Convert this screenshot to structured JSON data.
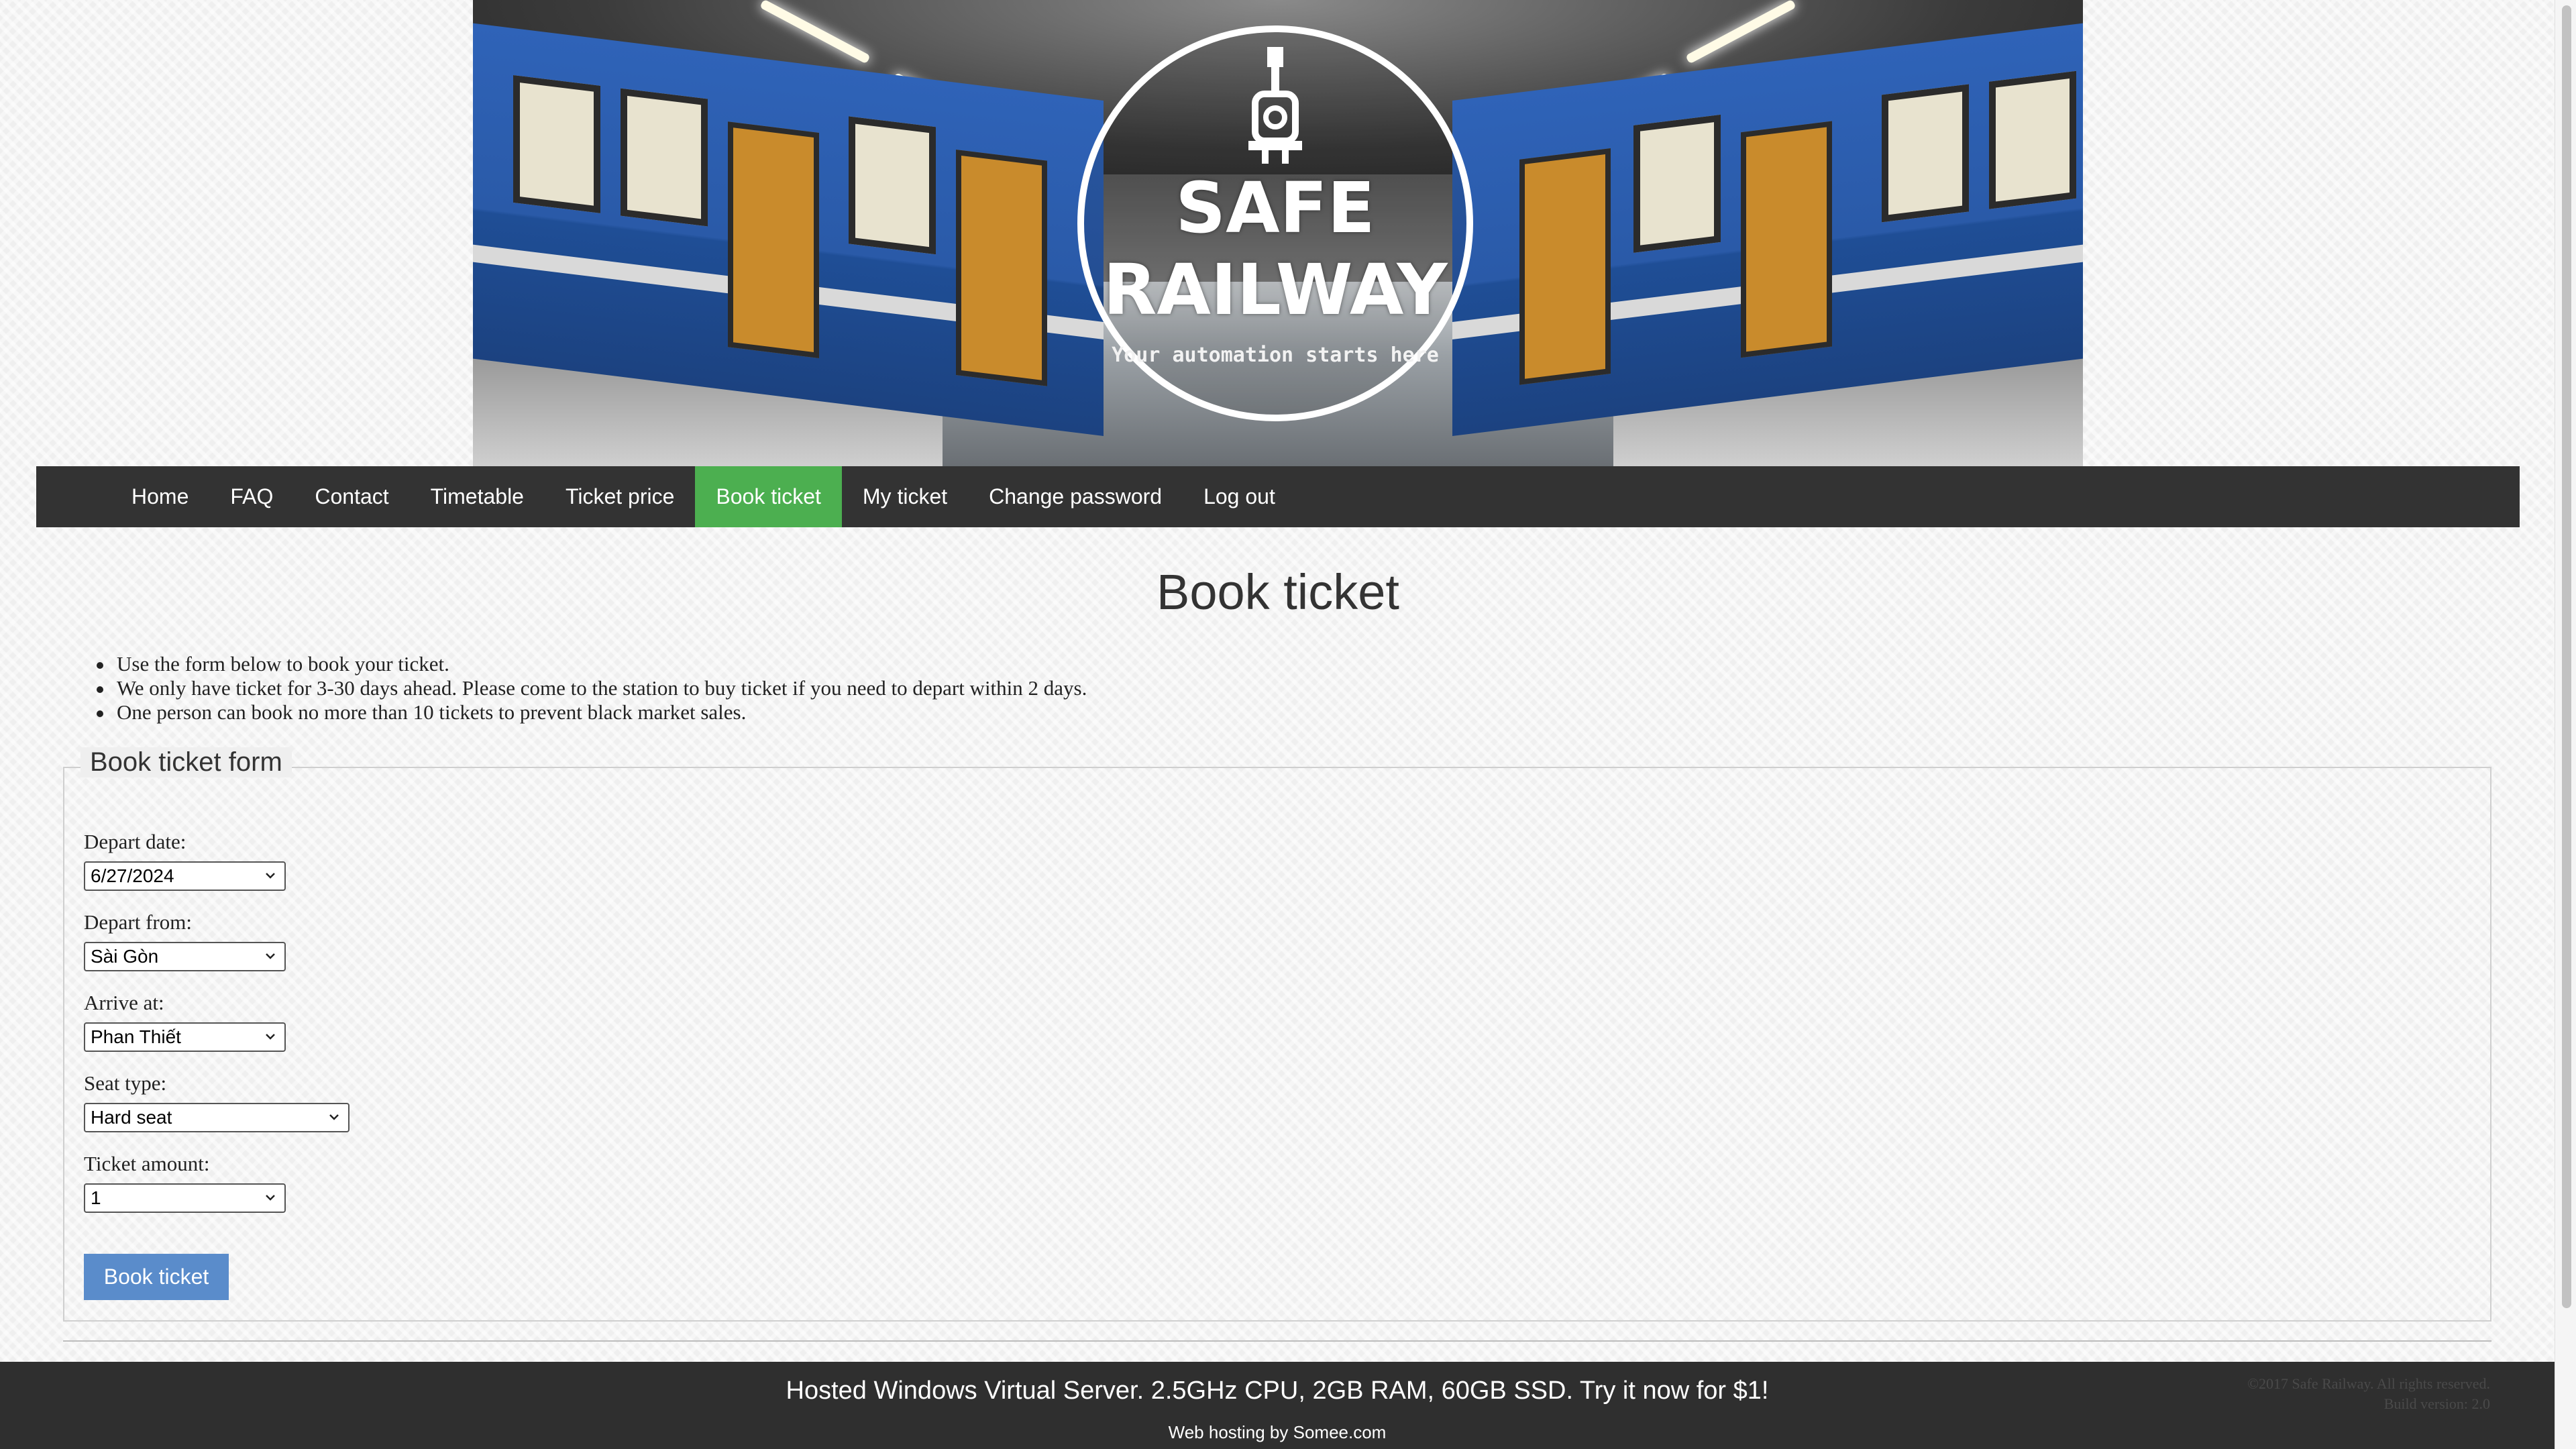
{
  "banner": {
    "title_line1": "SAFE",
    "title_line2": "RAILWAY",
    "tagline": "Your automation starts here"
  },
  "nav": {
    "items": [
      {
        "label": "Home"
      },
      {
        "label": "FAQ"
      },
      {
        "label": "Contact"
      },
      {
        "label": "Timetable"
      },
      {
        "label": "Ticket price"
      },
      {
        "label": "Book ticket",
        "active": true
      },
      {
        "label": "My ticket"
      },
      {
        "label": "Change password"
      },
      {
        "label": "Log out"
      }
    ],
    "active_color": "#4caf50",
    "background": "#333333"
  },
  "main": {
    "title": "Book ticket",
    "notes": [
      "Use the form below to book your ticket.",
      "We only have ticket for 3-30 days ahead. Please come to the station to buy ticket if you need to depart within 2 days.",
      "One person can book no more than 10 tickets to prevent black market sales."
    ]
  },
  "form": {
    "legend": "Book ticket form",
    "depart_date": {
      "label": "Depart date:",
      "value": "6/27/2024"
    },
    "depart_from": {
      "label": "Depart from:",
      "value": "Sài Gòn"
    },
    "arrive_at": {
      "label": "Arrive at:",
      "value": "Phan Thiết"
    },
    "seat_type": {
      "label": "Seat type:",
      "value": "Hard seat"
    },
    "ticket_amount": {
      "label": "Ticket amount:",
      "value": "1"
    },
    "submit_label": "Book ticket",
    "button_color": "#5a8ccb"
  },
  "footer": {
    "ad_text": "Hosted Windows Virtual Server. 2.5GHz CPU, 2GB RAM, 60GB SSD. Try it now for $1!",
    "hosting_text": "Web hosting by Somee.com",
    "copyright": "©2017 Safe Railway. All rights reserved.",
    "build": "Build version: 2.0"
  }
}
